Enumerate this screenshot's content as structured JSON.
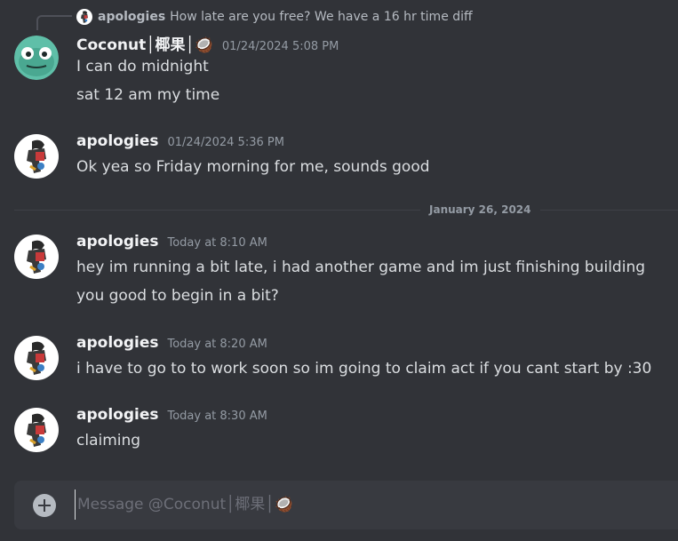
{
  "reply": {
    "username": "apologies",
    "text": "How late are you free? We have a 16 hr time diff"
  },
  "messages": [
    {
      "username": "Coconut│椰果│🥥",
      "timestamp": "01/24/2024 5:08 PM",
      "avatar": "coconut-avatar",
      "lines": [
        "I can do midnight",
        "sat 12 am my time"
      ]
    },
    {
      "username": "apologies",
      "timestamp": "01/24/2024 5:36 PM",
      "avatar": "apologies-avatar",
      "lines": [
        "Ok yea so Friday morning for me, sounds good"
      ]
    },
    {
      "username": "apologies",
      "timestamp": "Today at 8:10 AM",
      "avatar": "apologies-avatar",
      "lines": [
        "hey im running a bit late, i had another game and im just finishing building",
        "you good to begin in a bit?"
      ]
    },
    {
      "username": "apologies",
      "timestamp": "Today at 8:20 AM",
      "avatar": "apologies-avatar",
      "lines": [
        "i have to go to to work soon so im going to claim act if you cant start by :30"
      ]
    },
    {
      "username": "apologies",
      "timestamp": "Today at 8:30 AM",
      "avatar": "apologies-avatar",
      "lines": [
        "claiming"
      ]
    }
  ],
  "divider": {
    "label": "January 26, 2024"
  },
  "composer": {
    "placeholder": "Message @Coconut│椰果│🥥",
    "add_icon": "plus-circle-icon"
  },
  "colors": {
    "background": "#313338",
    "composer": "#383a40",
    "username": "#f2f3f5",
    "text": "#dbdee1",
    "muted": "#949ba4",
    "coconut_avatar": "#5fbfa8"
  }
}
